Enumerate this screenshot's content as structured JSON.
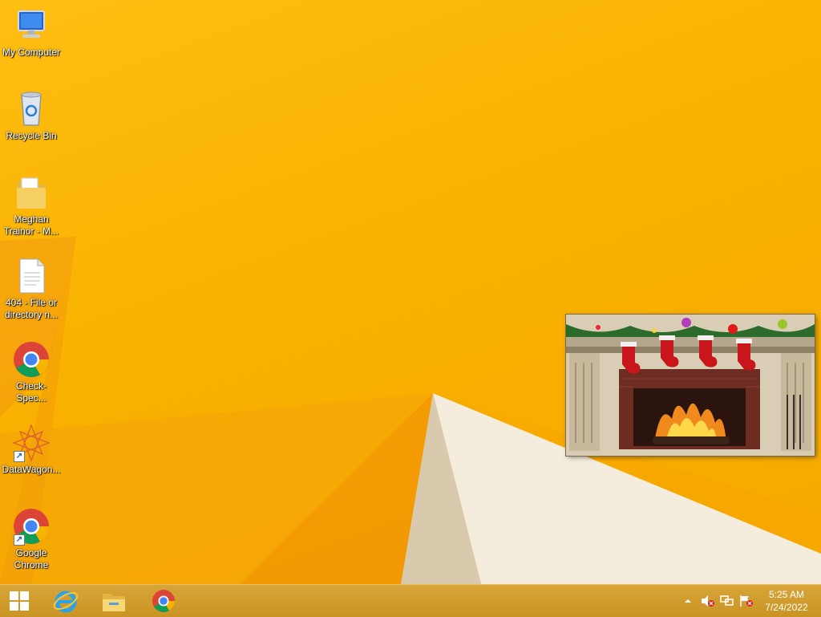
{
  "desktop": {
    "icons": [
      {
        "label": "My Computer",
        "icon": "computer-icon",
        "shortcut": false
      },
      {
        "label": "Recycle Bin",
        "icon": "recycle-bin-icon",
        "shortcut": false
      },
      {
        "label": "Meghan Trainor - M...",
        "icon": "folder-icon",
        "shortcut": false
      },
      {
        "label": "404 - File or directory n...",
        "icon": "text-file-icon",
        "shortcut": false
      },
      {
        "label": "Check-Spec...",
        "icon": "chrome-icon",
        "shortcut": false
      },
      {
        "label": "DataWagon...",
        "icon": "datawagon-icon",
        "shortcut": true
      },
      {
        "label": "Google Chrome",
        "icon": "chrome-icon",
        "shortcut": true
      }
    ],
    "widget": {
      "name": "christmas-fireplace-gadget"
    }
  },
  "taskbar": {
    "pinned": [
      {
        "name": "start-button",
        "icon": "windows-logo-icon"
      },
      {
        "name": "internet-explorer",
        "icon": "ie-icon"
      },
      {
        "name": "file-explorer",
        "icon": "file-explorer-icon"
      },
      {
        "name": "google-chrome",
        "icon": "chrome-icon"
      }
    ],
    "tray": {
      "icons": [
        "show-hidden-icons-chevron",
        "volume-muted-icon",
        "network-icon",
        "action-center-flag-icon"
      ]
    },
    "clock": {
      "time": "5:25 AM",
      "date": "7/24/2022"
    }
  },
  "colors": {
    "wallpaper": "#f9b200",
    "taskbar": "#d09c2c",
    "accent_white": "#f4ecdd"
  }
}
